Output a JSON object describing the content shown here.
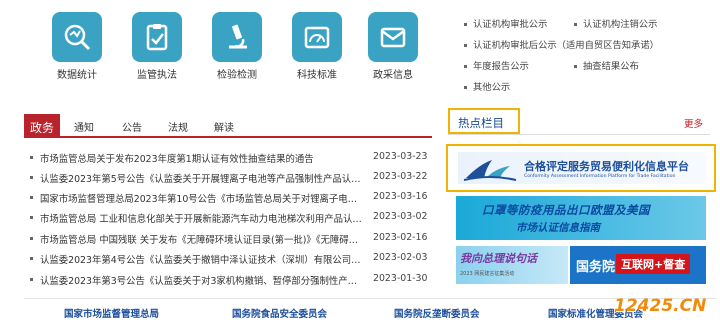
{
  "icons": [
    {
      "name": "数据统计",
      "icon": "data-statistics-icon"
    },
    {
      "name": "监管执法",
      "icon": "clipboard-check-icon"
    },
    {
      "name": "检验检测",
      "icon": "microscope-icon"
    },
    {
      "name": "科技标准",
      "icon": "gauge-icon"
    },
    {
      "name": "政采信息",
      "icon": "envelope-icon"
    }
  ],
  "right_links": [
    "认证机构审批公示",
    "认证机构注销公示",
    "认证机构审批后公示（适用自贸区告知承诺）",
    "年度报告公示",
    "抽查结果公布",
    "其他公示"
  ],
  "tabs": [
    "政务",
    "通知",
    "公告",
    "法规",
    "解读"
  ],
  "news": [
    {
      "title": "市场监管总局关于发布2023年度第1期认证有效性抽查结果的通告",
      "date": "2023-03-23"
    },
    {
      "title": "认监委2023年第5号公告《认监委关于开展锂离子电池等产品强制性产品认证...",
      "date": "2023-03-22"
    },
    {
      "title": "国家市场监督管理总局2023年第10号公告《市场监管总局关于对锂离子电池等...",
      "date": "2023-03-16"
    },
    {
      "title": "市场监管总局 工业和信息化部关于开展新能源汽车动力电池梯次利用产品认证...",
      "date": "2023-03-02"
    },
    {
      "title": "市场监管总局 中国残联 关于发布《无障碍环境认证目录(第一批)》《无障碍环...",
      "date": "2023-02-16"
    },
    {
      "title": "认监委2023年第4号公告《认监委关于撤销中泽认证技术（深圳）有限公司等1...",
      "date": "2023-02-03"
    },
    {
      "title": "认监委2023年第3号公告《认监委关于对3家机构撤销、暂停部分强制性产品认...",
      "date": "2023-01-30"
    }
  ],
  "hot_title": "热点栏目",
  "more": "更多",
  "banner1": {
    "cn": "合格评定服务贸易便利化信息平台",
    "en": "Conformity Assessment Information Platform for Trade Facilitation"
  },
  "banner2": {
    "line1": "口罩等防疫用品出口欧盟及美国",
    "line2": "市场认证信息指南"
  },
  "banner3": {
    "title": "我向总理说句话",
    "sub": "2023 网民建言征集活动"
  },
  "banner4": {
    "title": "国务院",
    "box": "互联网+督查"
  },
  "footer": [
    "国家市场监督管理总局",
    "国务院食品安全委员会",
    "国务院反垄断委员会",
    "国家标准化管理委员会"
  ],
  "watermark": "12425.CN",
  "colors": {
    "accent_red": "#b8232c",
    "icon_teal": "#3aa3c4",
    "highlight": "#f0b400",
    "link_blue": "#1d4f9b"
  }
}
